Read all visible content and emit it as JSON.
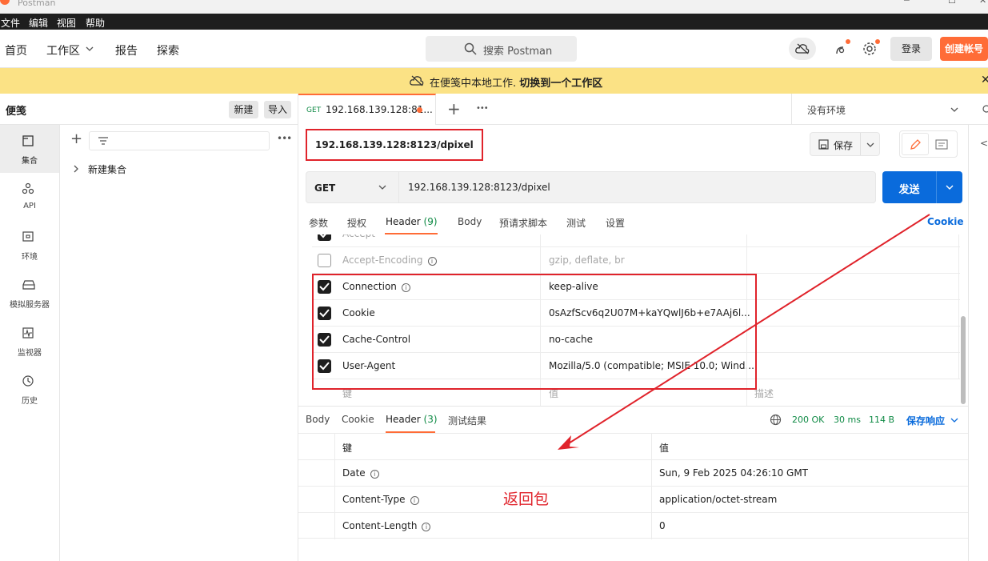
{
  "window": {
    "title": "Postman"
  },
  "menubar": {
    "items": [
      "文件",
      "编辑",
      "视图",
      "帮助"
    ]
  },
  "header": {
    "nav": {
      "home": "首页",
      "workspace": "工作区",
      "reports": "报告",
      "explore": "探索"
    },
    "search_placeholder": "搜索 Postman",
    "login": "登录",
    "signup": "创建帐号"
  },
  "banner": {
    "text": "在便笺中本地工作.",
    "link": "切换到一个工作区"
  },
  "sidebar": {
    "title": "便笺",
    "new_button": "新建",
    "import_button": "导入",
    "rail": [
      {
        "label": "集合",
        "icon": "collections-icon"
      },
      {
        "label": "API",
        "icon": "api-icon"
      },
      {
        "label": "环境",
        "icon": "environment-icon"
      },
      {
        "label": "模拟服务器",
        "icon": "mock-server-icon"
      },
      {
        "label": "监视器",
        "icon": "monitor-icon"
      },
      {
        "label": "历史",
        "icon": "history-icon"
      }
    ],
    "collection_item": "新建集合"
  },
  "tabs": {
    "active": {
      "method": "GET",
      "name": "192.168.139.128:81..."
    },
    "environment": "没有环境"
  },
  "request": {
    "title": "192.168.139.128:8123/dpixel",
    "save": "保存",
    "method": "GET",
    "url": "192.168.139.128:8123/dpixel",
    "send": "发送",
    "cookie_link": "Cookie",
    "subtabs": [
      "参数",
      "授权",
      "Header",
      "Body",
      "预请求脚本",
      "测试",
      "设置"
    ],
    "header_count": "(9)",
    "headers": [
      {
        "key": "Accept",
        "value": "*",
        "checked": true
      },
      {
        "key": "Accept-Encoding",
        "value": "gzip, deflate, br",
        "checked": false
      },
      {
        "key": "Connection",
        "value": "keep-alive",
        "checked": true
      },
      {
        "key": "Cookie",
        "value": "0sAzfScv6q2U07M+kaYQwlJ6b+e7AAj6l...",
        "checked": true
      },
      {
        "key": "Cache-Control",
        "value": "no-cache",
        "checked": true
      },
      {
        "key": "User-Agent",
        "value": "Mozilla/5.0 (compatible; MSIE 10.0; Wind...",
        "checked": true
      }
    ],
    "placeholder_row": {
      "key": "键",
      "value": "值",
      "desc": "描述"
    }
  },
  "response": {
    "tabs": [
      "Body",
      "Cookie",
      "Header",
      "测试结果"
    ],
    "header_count": "(3)",
    "status": "200 OK",
    "time": "30 ms",
    "size": "114 B",
    "save": "保存响应",
    "col_key": "键",
    "col_value": "值",
    "headers": [
      {
        "key": "Date",
        "value": "Sun, 9 Feb 2025 04:26:10 GMT"
      },
      {
        "key": "Content-Type",
        "value": "application/octet-stream"
      },
      {
        "key": "Content-Length",
        "value": "0"
      }
    ],
    "annotation": "返回包"
  },
  "colors": {
    "accent": "#ff6c37",
    "primary": "#0a6bdc",
    "annotation": "#e0232b",
    "banner": "#fbe285"
  }
}
